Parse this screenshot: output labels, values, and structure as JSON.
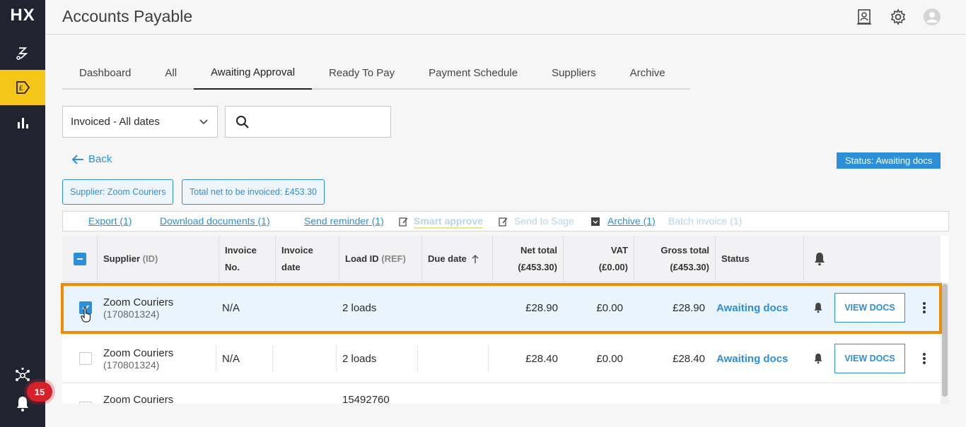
{
  "app": {
    "logo": "HX",
    "title": "Accounts Payable"
  },
  "sidebar": {
    "notification_count": "15"
  },
  "tabs": [
    {
      "label": "Dashboard"
    },
    {
      "label": "All"
    },
    {
      "label": "Awaiting Approval"
    },
    {
      "label": "Ready To Pay"
    },
    {
      "label": "Payment Schedule"
    },
    {
      "label": "Suppliers"
    },
    {
      "label": "Archive"
    }
  ],
  "active_tab": "Awaiting Approval",
  "filters": {
    "date_select": "Invoiced - All dates",
    "search_placeholder": ""
  },
  "back_label": "Back",
  "status_pill": "Status: Awaiting docs",
  "chips": {
    "supplier": "Supplier: Zoom Couriers",
    "total": "Total net to be invoiced: £453.30"
  },
  "actions": {
    "export": "Export (1)",
    "download": "Download documents (1)",
    "reminder": "Send reminder (1)",
    "smart_approve": "Smart approve",
    "send_sage": "Send to Sage",
    "archive": "Archive (1)",
    "batch_invoice": "Batch invoice (1)"
  },
  "table": {
    "headers": {
      "supplier": "Supplier",
      "supplier_id": "(ID)",
      "invoice_no_1": "Invoice",
      "invoice_no_2": "No.",
      "invoice_date_1": "Invoice",
      "invoice_date_2": "date",
      "load_id": "Load ID",
      "load_ref": "(REF)",
      "due_date": "Due date",
      "net_total_1": "Net total",
      "net_total_2": "(£453.30)",
      "vat_1": "VAT",
      "vat_2": "(£0.00)",
      "gross_total_1": "Gross total",
      "gross_total_2": "(£453.30)",
      "status": "Status"
    },
    "rows": [
      {
        "supplier": "Zoom Couriers",
        "supplier_id": "(170801324)",
        "invoice_no": "N/A",
        "invoice_date": "",
        "load_id": "2 loads",
        "due_date": "",
        "net": "£28.90",
        "vat": "£0.00",
        "gross": "£28.90",
        "status": "Awaiting docs",
        "button": "VIEW DOCS",
        "checked": true
      },
      {
        "supplier": "Zoom Couriers",
        "supplier_id": "(170801324)",
        "invoice_no": "N/A",
        "invoice_date": "",
        "load_id": "2 loads",
        "due_date": "",
        "net": "£28.40",
        "vat": "£0.00",
        "gross": "£28.40",
        "status": "Awaiting docs",
        "button": "VIEW DOCS",
        "checked": false
      },
      {
        "supplier": "Zoom Couriers",
        "supplier_id": "",
        "invoice_no": "",
        "invoice_date": "",
        "load_id": "15492760",
        "due_date": "",
        "net": "",
        "vat": "",
        "gross": "",
        "status": "",
        "button": "",
        "checked": false
      }
    ]
  },
  "colors": {
    "accent": "#2d8fd8",
    "highlight": "#f08c00",
    "sidebar": "#222330",
    "active_nav": "#f5c518"
  }
}
